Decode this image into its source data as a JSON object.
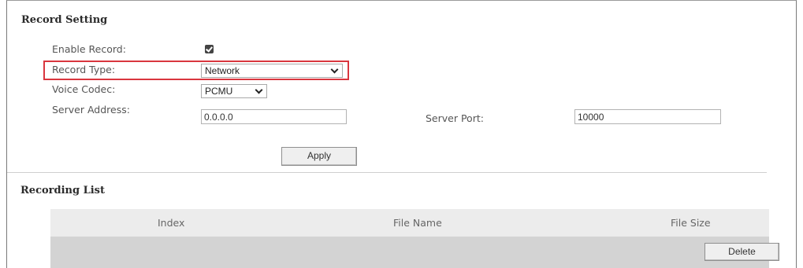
{
  "record_setting": {
    "title": "Record Setting",
    "enable_record": {
      "label": "Enable Record:",
      "checked": true
    },
    "record_type": {
      "label": "Record Type:",
      "value": "Network"
    },
    "voice_codec": {
      "label": "Voice Codec:",
      "value": "PCMU"
    },
    "server_address": {
      "label": "Server Address:",
      "value": "0.0.0.0"
    },
    "server_port": {
      "label": "Server Port:",
      "value": "10000"
    },
    "apply_label": "Apply"
  },
  "recording_list": {
    "title": "Recording List",
    "columns": [
      "Index",
      "File Name",
      "File Size"
    ],
    "delete_label": "Delete"
  },
  "colors": {
    "highlight": "#d9363e",
    "table_header_bg": "#ececec",
    "table_row_bg": "#d3d3d3"
  }
}
